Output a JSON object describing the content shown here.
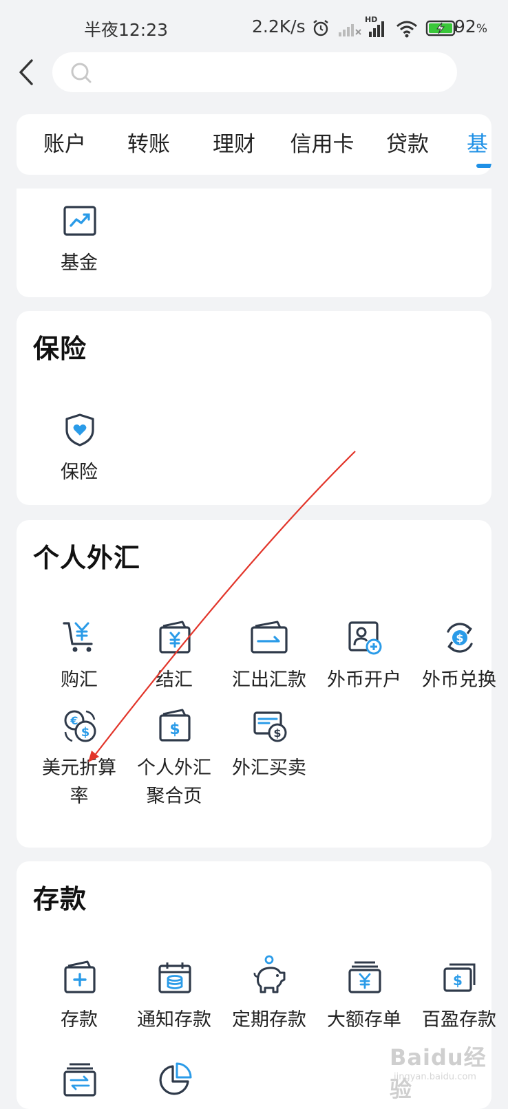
{
  "status_bar": {
    "time": "半夜12:23",
    "net_speed": "2.2K/s",
    "battery_level": "92",
    "battery_unit": "%",
    "hd_badge": "HD",
    "icons": [
      "alarm-icon",
      "signal-off-icon",
      "hd-signal-icon",
      "wifi-icon",
      "battery-charging-icon"
    ]
  },
  "search": {
    "placeholder": ""
  },
  "tabs": {
    "items": [
      "账户",
      "转账",
      "理财",
      "信用卡",
      "贷款",
      "基"
    ],
    "active_index": 5,
    "accent": "#1e90e6"
  },
  "fund_section": {
    "items": [
      {
        "label": "基金",
        "icon": "chart-trend-icon"
      }
    ]
  },
  "insurance_section": {
    "title": "保险",
    "items": [
      {
        "label": "保险",
        "icon": "shield-heart-icon"
      }
    ]
  },
  "forex_section": {
    "title": "个人外汇",
    "items": [
      {
        "label": "购汇",
        "icon": "cart-yen-icon"
      },
      {
        "label": "结汇",
        "icon": "wallet-yen-icon"
      },
      {
        "label": "汇出汇款",
        "icon": "remit-card-icon"
      },
      {
        "label": "外币开户",
        "icon": "account-add-icon"
      },
      {
        "label": "外币兑换",
        "icon": "exchange-dollar-icon"
      },
      {
        "label_line1": "美元折算",
        "label_line2": "率",
        "icon": "euro-dollar-icon"
      },
      {
        "label_line1": "个人外汇",
        "label_line2": "聚合页",
        "icon": "wallet-dollar-icon"
      },
      {
        "label": "外汇买卖",
        "icon": "bill-dollar-icon"
      }
    ]
  },
  "deposit_section": {
    "title": "存款",
    "items": [
      {
        "label": "存款",
        "icon": "card-plus-icon"
      },
      {
        "label": "通知存款",
        "icon": "calendar-coins-icon"
      },
      {
        "label": "定期存款",
        "icon": "piggy-bank-icon"
      },
      {
        "label": "大额存单",
        "icon": "stacked-yen-icon"
      },
      {
        "label": "百盈存款",
        "icon": "stacked-dollar-icon"
      },
      {
        "label": "",
        "icon": "transfer-stack-icon"
      },
      {
        "label": "",
        "icon": "pie-chart-icon"
      }
    ]
  },
  "colors": {
    "accent": "#1e90e6",
    "icon_dark": "#2f3a4a",
    "icon_accent": "#2a9be8",
    "annotation_arrow": "#e2352a"
  },
  "watermark": {
    "text": "Baidu经验",
    "sub": "jingyan.baidu.com"
  }
}
